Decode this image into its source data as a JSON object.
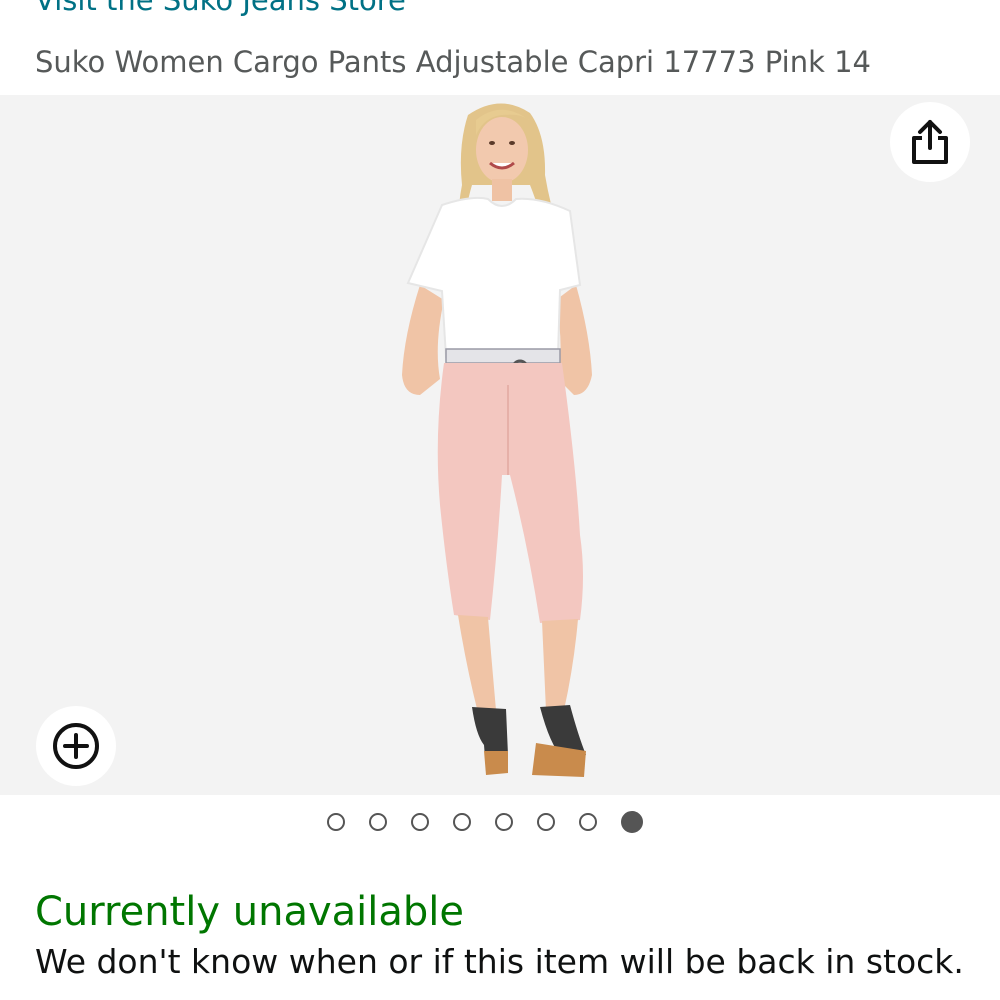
{
  "store": {
    "link_label": "Visit the Suko Jeans Store"
  },
  "product": {
    "title": "Suko Women Cargo Pants Adjustable Capri 17773 Pink 14",
    "image_icon": "product-photo-woman-pink-capri-pants"
  },
  "gallery": {
    "share_icon": "share-icon",
    "zoom_icon": "zoom-plus-icon",
    "total_images": 8,
    "active_index": 8
  },
  "availability": {
    "status": "Currently unavailable",
    "note": "We don't know when or if this item will be back in stock.",
    "status_color": "#007600"
  },
  "colors": {
    "link": "#007185",
    "subtitle": "#565959",
    "image_background": "#f3f3f3"
  }
}
